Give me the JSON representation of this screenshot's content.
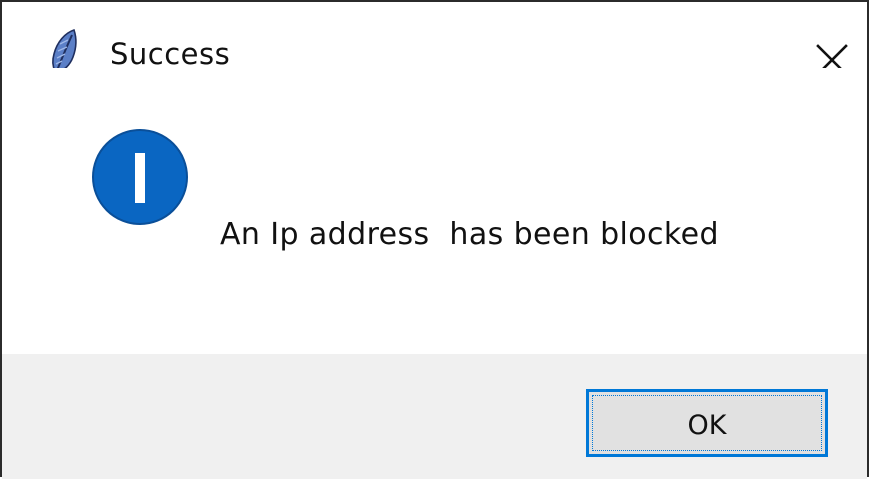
{
  "window": {
    "title": "Success",
    "title_icon": "feather-icon",
    "close_icon": "close-icon"
  },
  "dialog": {
    "icon": "info-icon",
    "message": "An Ip address  has been blocked",
    "ok_label": "OK"
  },
  "colors": {
    "accent": "#0078d7",
    "info_icon_fill": "#0a66c2",
    "footer_background": "#f0f0f0",
    "button_background": "#e1e1e1"
  }
}
